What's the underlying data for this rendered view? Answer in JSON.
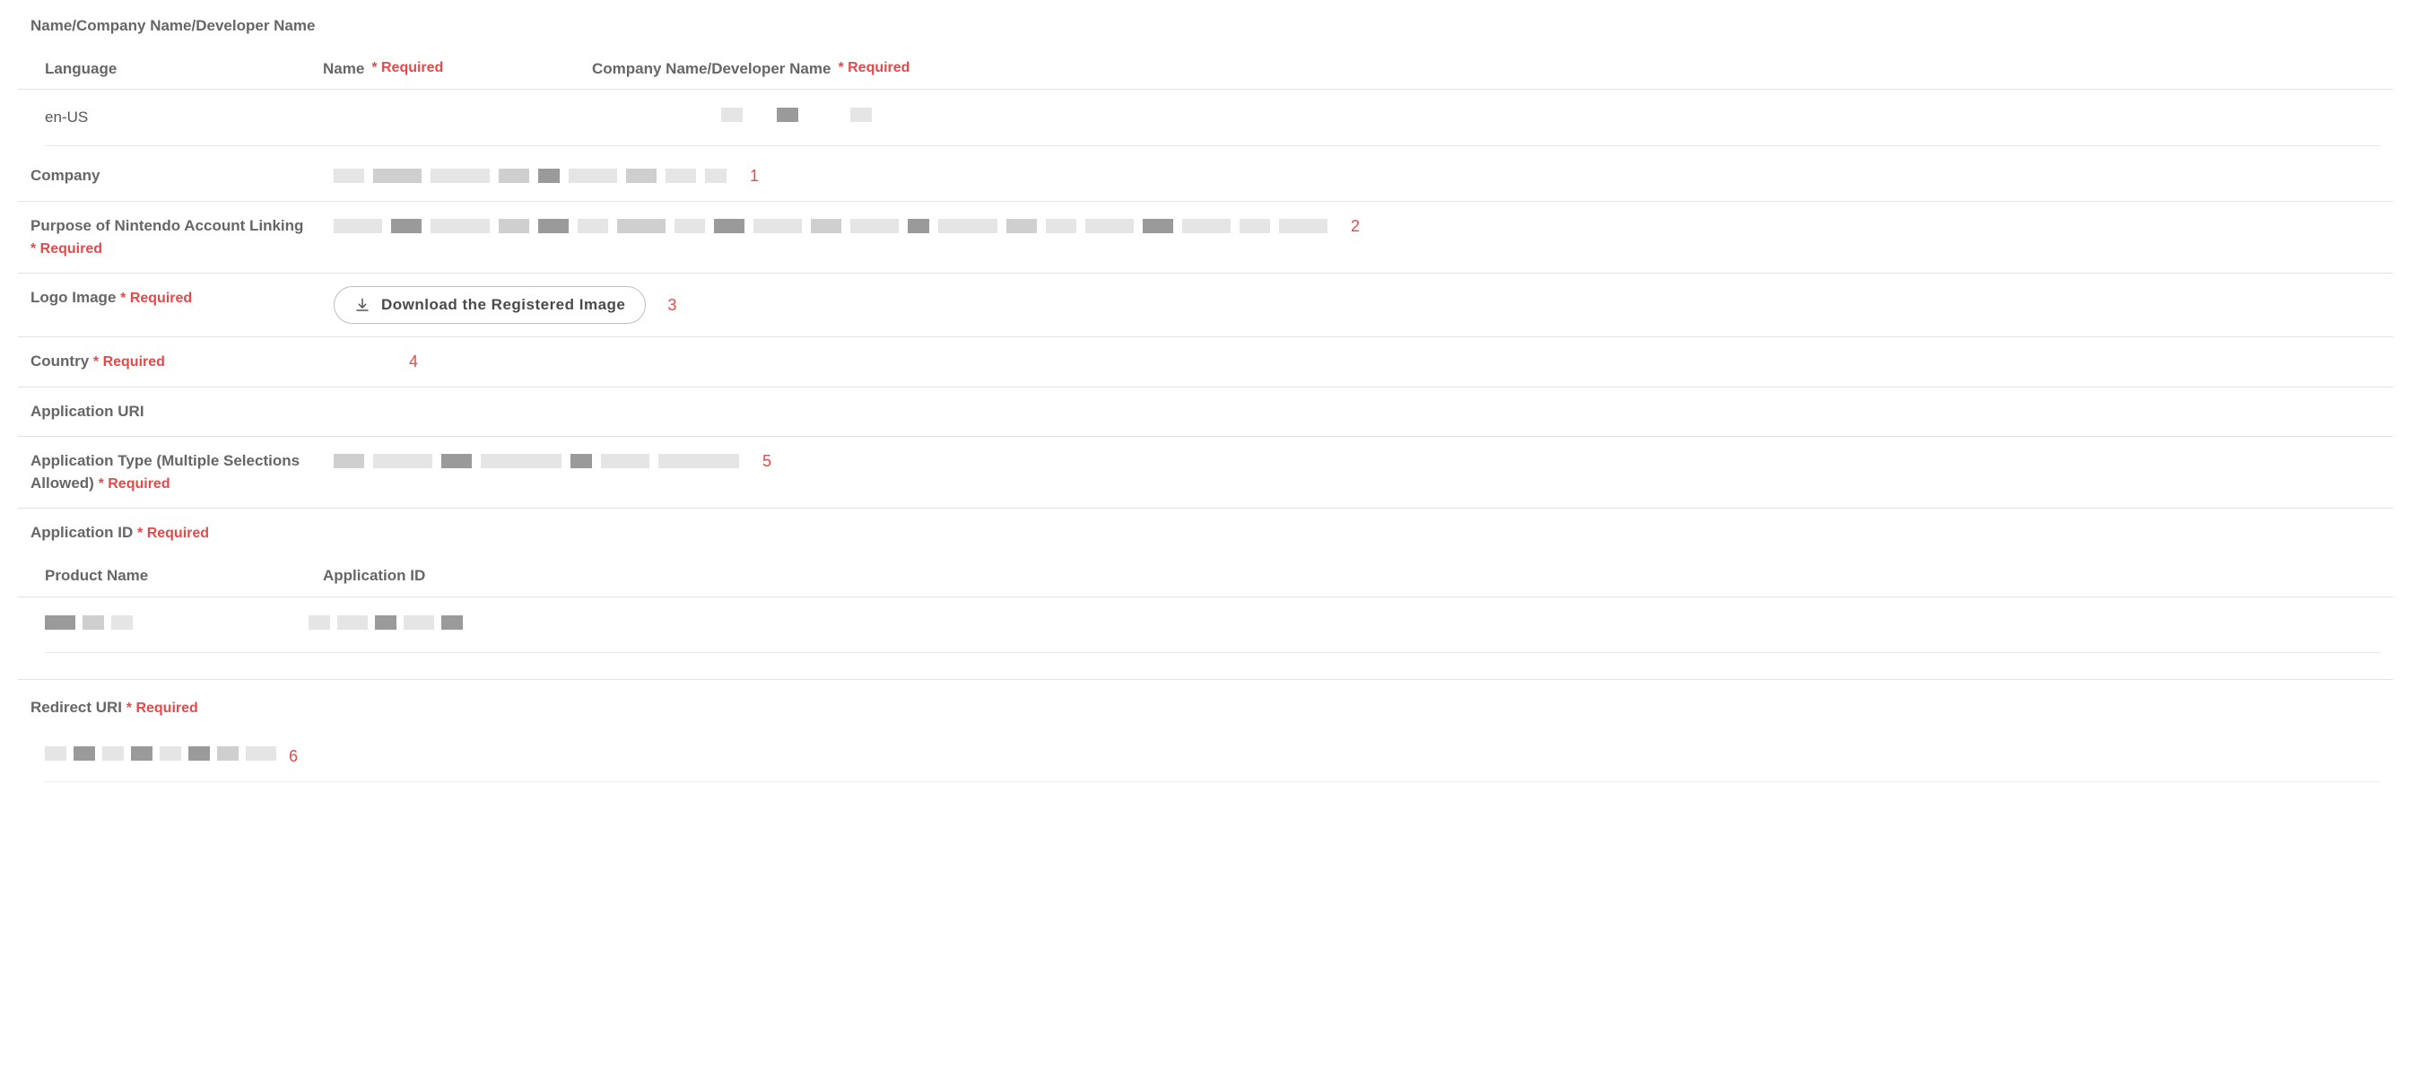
{
  "required_text": "* Required",
  "section1": {
    "title": "Name/Company Name/Developer Name",
    "headers": {
      "language": "Language",
      "name": "Name",
      "company_dev": "Company Name/Developer Name"
    },
    "row": {
      "language": "en-US"
    }
  },
  "fields": {
    "company": {
      "label": "Company",
      "annot": "1"
    },
    "purpose": {
      "label": "Purpose of Nintendo Account Linking",
      "annot": "2"
    },
    "logo": {
      "label": "Logo Image",
      "button": "Download the Registered Image",
      "annot": "3"
    },
    "country": {
      "label": "Country",
      "annot": "4"
    },
    "app_uri": {
      "label": "Application URI"
    },
    "app_type": {
      "label": "Application Type (Multiple Selections Allowed)",
      "annot": "5"
    },
    "app_id": {
      "label": "Application ID",
      "headers": {
        "product": "Product Name",
        "id": "Application ID"
      }
    },
    "redirect": {
      "label": "Redirect URI",
      "annot": "6"
    }
  }
}
